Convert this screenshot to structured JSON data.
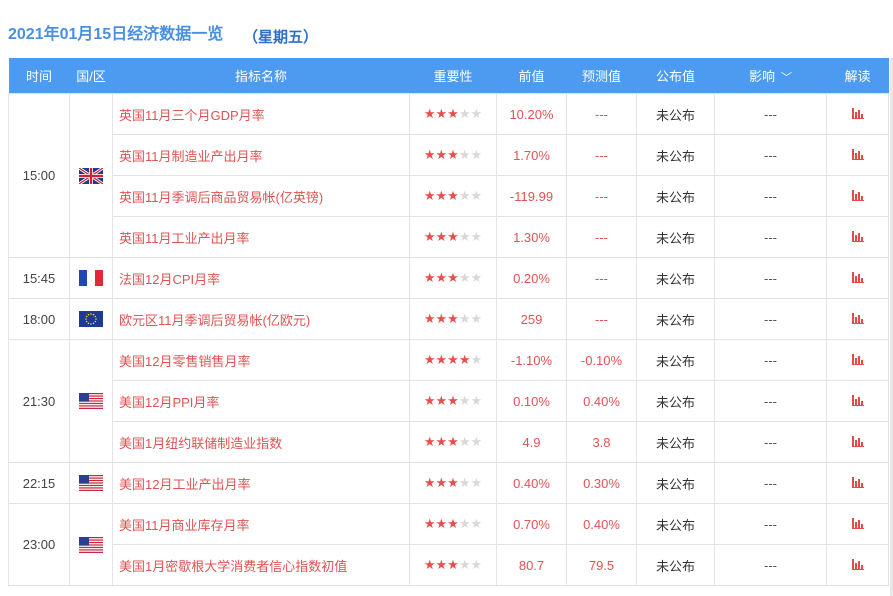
{
  "header": {
    "title": "2021年01月15日经济数据一览",
    "weekday": "（星期五）"
  },
  "columns": {
    "time": "时间",
    "region": "国/区",
    "name": "指标名称",
    "importance": "重要性",
    "previous": "前值",
    "forecast": "预测值",
    "published": "公布值",
    "impact": "影响",
    "analysis": "解读"
  },
  "rows": [
    {
      "time": "15:00",
      "flag": "uk-flag-icon",
      "name": "英国11月三个月GDP月率",
      "stars": 3,
      "previous": "10.20%",
      "forecast": "---",
      "published": "未公布",
      "impact": "---"
    },
    {
      "time": "",
      "flag": "",
      "name": "英国11月制造业产出月率",
      "stars": 3,
      "previous": "1.70%",
      "forecast": "---",
      "published": "未公布",
      "impact": "---"
    },
    {
      "time": "",
      "flag": "",
      "name": "英国11月季调后商品贸易帐(亿英镑)",
      "stars": 3,
      "previous": "-119.99",
      "forecast": "---",
      "published": "未公布",
      "impact": "---"
    },
    {
      "time": "",
      "flag": "",
      "name": "英国11月工业产出月率",
      "stars": 3,
      "previous": "1.30%",
      "forecast": "---",
      "published": "未公布",
      "impact": "---"
    },
    {
      "time": "15:45",
      "flag": "france-flag-icon",
      "name": "法国12月CPI月率",
      "stars": 3,
      "previous": "0.20%",
      "forecast": "---",
      "published": "未公布",
      "impact": "---"
    },
    {
      "time": "18:00",
      "flag": "eu-flag-icon",
      "name": "欧元区11月季调后贸易帐(亿欧元)",
      "stars": 3,
      "previous": "259",
      "forecast": "---",
      "published": "未公布",
      "impact": "---"
    },
    {
      "time": "21:30",
      "flag": "us-flag-icon",
      "name": "美国12月零售销售月率",
      "stars": 4,
      "previous": "-1.10%",
      "forecast": "-0.10%",
      "published": "未公布",
      "impact": "---"
    },
    {
      "time": "",
      "flag": "",
      "name": "美国12月PPI月率",
      "stars": 3,
      "previous": "0.10%",
      "forecast": "0.40%",
      "published": "未公布",
      "impact": "---"
    },
    {
      "time": "",
      "flag": "",
      "name": "美国1月纽约联储制造业指数",
      "stars": 3,
      "previous": "4.9",
      "forecast": "3.8",
      "published": "未公布",
      "impact": "---"
    },
    {
      "time": "22:15",
      "flag": "us-flag-icon",
      "name": "美国12月工业产出月率",
      "stars": 3,
      "previous": "0.40%",
      "forecast": "0.30%",
      "published": "未公布",
      "impact": "---"
    },
    {
      "time": "23:00",
      "flag": "us-flag-icon",
      "name": "美国11月商业库存月率",
      "stars": 3,
      "previous": "0.70%",
      "forecast": "0.40%",
      "published": "未公布",
      "impact": "---"
    },
    {
      "time": "",
      "flag": "",
      "name": "美国1月密歇根大学消费者信心指数初值",
      "stars": 3,
      "previous": "80.7",
      "forecast": "79.5",
      "published": "未公布",
      "impact": "---"
    }
  ],
  "groups": [
    {
      "time_row": 0,
      "span": 4
    },
    {
      "time_row": 4,
      "span": 1
    },
    {
      "time_row": 5,
      "span": 1
    },
    {
      "time_row": 6,
      "span": 3
    },
    {
      "time_row": 9,
      "span": 1
    },
    {
      "time_row": 10,
      "span": 2
    }
  ],
  "colors": {
    "header_bg": "#4d9bf0",
    "title": "#4a8fe0",
    "star_on": "#e84e4e",
    "star_off": "#d8d8d8",
    "link_red": "#e05353"
  }
}
